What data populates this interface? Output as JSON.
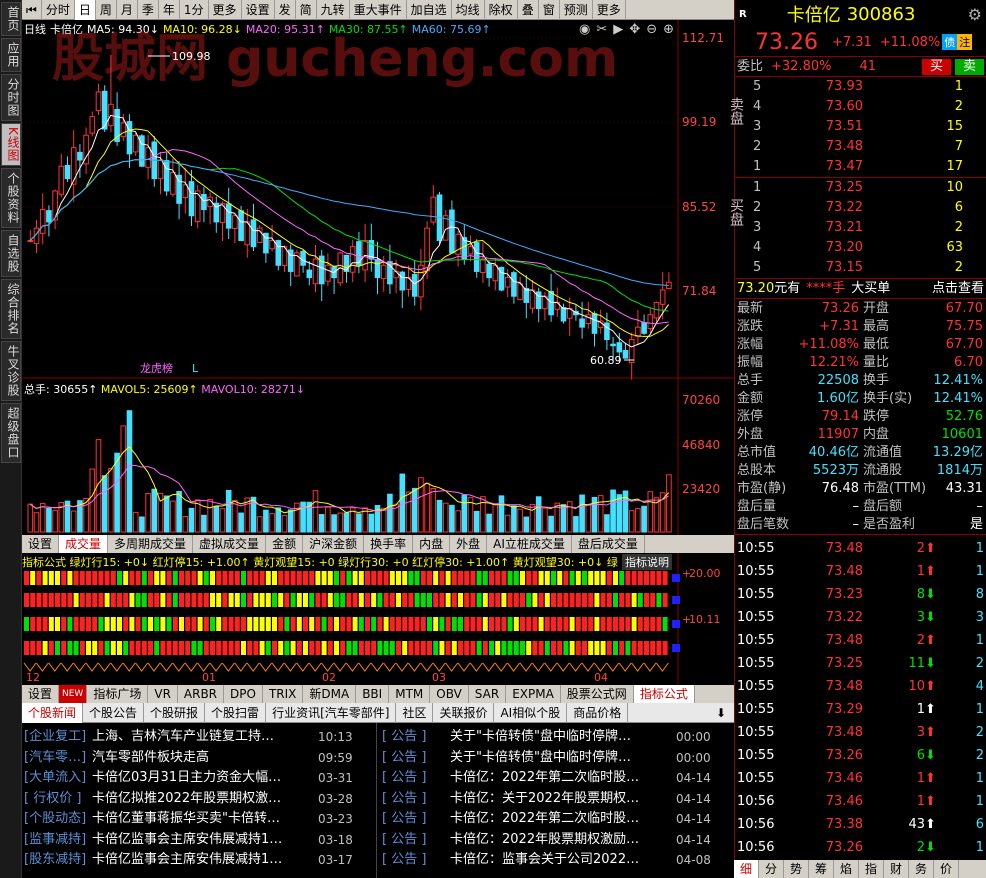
{
  "left_tabs": [
    "首页",
    "应用",
    "分时图",
    "K线图",
    "个股资料",
    "自选股",
    "综合排名",
    "牛叉诊股",
    "超级盘口"
  ],
  "toolbar": [
    "分时",
    "日",
    "周",
    "月",
    "季",
    "年",
    "1分",
    "更多",
    "设置",
    "发",
    "简",
    "九转",
    "重大事件",
    "加自选",
    "均线",
    "除权",
    "叠",
    "窗",
    "预测",
    "更多"
  ],
  "watermark": "股城网 gucheng.com",
  "chart_head": {
    "type": "日线",
    "name": "卡倍亿",
    "ma5": "MA5: 94.30↓",
    "ma10": "MA10: 96.28↓",
    "ma20": "MA20: 95.31↑",
    "ma30": "MA30: 87.55↑",
    "ma60": "MA60: 75.69↑"
  },
  "price_axis": [
    "112.71",
    "99.19",
    "85.52",
    "71.84"
  ],
  "high_label": "109.98",
  "low_label": "60.89",
  "markers": [
    "龙虎榜",
    "L"
  ],
  "vol_head": {
    "total": "总手: 30655↑",
    "mavol5": "MAVOL5: 25609↑",
    "mavol10": "MAVOL10: 28271↓"
  },
  "vol_axis": [
    "70260",
    "46840",
    "23420"
  ],
  "tabs1": [
    "设置",
    "成交量",
    "多周期成交量",
    "虚拟成交量",
    "金额",
    "沪深金额",
    "换手率",
    "内盘",
    "外盘",
    "AI立桩成交量",
    "盘后成交量"
  ],
  "ind_head": "指标公式 绿灯行15: +0↓ 红灯停15: +1.00↑ 黄灯观望15: +0 绿灯行30: +0 红灯停30: +1.00↑ 黄灯观望30: +0↓ 绿",
  "ind_head_right": "指标说明",
  "ind_axis": [
    "20.00",
    "10.11"
  ],
  "date_axis": [
    "12",
    "01",
    "02",
    "03",
    "04"
  ],
  "tabs2": [
    "设置",
    "NEW",
    "指标广场",
    "VR",
    "ARBR",
    "DPO",
    "TRIX",
    "新DMA",
    "BBI",
    "MTM",
    "OBV",
    "SAR",
    "EXPMA",
    "股票公式网",
    "指标公式"
  ],
  "news_tabs": [
    "个股新闻",
    "个股公告",
    "个股研报",
    "个股扫雷",
    "行业资讯[汽车零部件]",
    "社区",
    "关联报价",
    "AI相似个股",
    "商品价格"
  ],
  "news_left": [
    {
      "cat": "[企业复工]",
      "title": "上海、吉林汽车产业链复工持…",
      "date": "10:13"
    },
    {
      "cat": "[汽车零…]",
      "title": "汽车零部件板块走高",
      "date": "09:59"
    },
    {
      "cat": "[大单流入]",
      "title": "卡倍亿03月31日主力资金大幅…",
      "date": "03-31"
    },
    {
      "cat": "[ 行权价 ]",
      "title": "卡倍亿拟推2022年股票期权激…",
      "date": "03-28"
    },
    {
      "cat": "[个股动态]",
      "title": "卡倍亿董事蒋振华买卖\"卡倍转…",
      "date": "03-23"
    },
    {
      "cat": "[监事减持]",
      "title": "卡倍亿监事会主席安伟展减持1…",
      "date": "03-18"
    },
    {
      "cat": "[股东减持]",
      "title": "卡倍亿监事会主席安伟展减持1…",
      "date": "03-17"
    }
  ],
  "news_right": [
    {
      "cat": "[  公告  ]",
      "title": "关于\"卡倍转债\"盘中临时停牌…",
      "date": "00:00"
    },
    {
      "cat": "[  公告  ]",
      "title": "关于\"卡倍转债\"盘中临时停牌…",
      "date": "00:00"
    },
    {
      "cat": "[  公告  ]",
      "title": "卡倍亿：2022年第二次临时股…",
      "date": "04-14"
    },
    {
      "cat": "[  公告  ]",
      "title": "卡倍亿：关于2022年股票期权…",
      "date": "04-14"
    },
    {
      "cat": "[  公告  ]",
      "title": "卡倍亿：2022年第二次临时股…",
      "date": "04-14"
    },
    {
      "cat": "[  公告  ]",
      "title": "卡倍亿：2022年股票期权激励…",
      "date": "04-14"
    },
    {
      "cat": "[  公告  ]",
      "title": "卡倍亿：监事会关于公司2022…",
      "date": "04-08"
    }
  ],
  "quote": {
    "r": "R",
    "name": "卡倍亿",
    "code": "300863",
    "price": "73.26",
    "chg": "+7.31",
    "pct": "+11.08%",
    "tag1": "债",
    "tag2": "注",
    "weibi_label": "委比",
    "weibi": "+32.80%",
    "weicha": "41",
    "buy": "买",
    "sell": "卖",
    "sell_label": "卖盘",
    "buy_label": "买盘",
    "asks": [
      [
        "5",
        "73.93",
        "1"
      ],
      [
        "4",
        "73.60",
        "2"
      ],
      [
        "3",
        "73.51",
        "15"
      ],
      [
        "2",
        "73.48",
        "7"
      ],
      [
        "1",
        "73.47",
        "17"
      ]
    ],
    "bids": [
      [
        "1",
        "73.25",
        "10"
      ],
      [
        "2",
        "73.22",
        "6"
      ],
      [
        "3",
        "73.21",
        "2"
      ],
      [
        "4",
        "73.20",
        "63"
      ],
      [
        "5",
        "73.15",
        "2"
      ]
    ],
    "bigorder": {
      "price": "73.20",
      "unit": "元有",
      "hands": "****手",
      "label": "大买单",
      "link": "点击查看"
    },
    "stats": [
      [
        "最新",
        "73.26",
        "开盘",
        "67.70"
      ],
      [
        "涨跌",
        "+7.31",
        "最高",
        "75.75"
      ],
      [
        "涨幅",
        "+11.08%",
        "最低",
        "67.70"
      ],
      [
        "振幅",
        "12.21%",
        "量比",
        "6.70"
      ],
      [
        "总手",
        "22508",
        "换手",
        "12.41%"
      ],
      [
        "金额",
        "1.60亿",
        "换手(实)",
        "12.41%"
      ],
      [
        "涨停",
        "79.14",
        "跌停",
        "52.76"
      ],
      [
        "外盘",
        "11907",
        "内盘",
        "10601"
      ],
      [
        "总市值",
        "40.46亿",
        "流通值",
        "13.29亿"
      ],
      [
        "总股本",
        "5523万",
        "流通股",
        "1814万"
      ],
      [
        "市盈(静)",
        "76.48",
        "市盈(TTM)",
        "43.31"
      ],
      [
        "盘后量",
        "–",
        "盘后额",
        "–"
      ],
      [
        "盘后笔数",
        "–",
        "是否盈利",
        "是"
      ]
    ],
    "ticks": [
      [
        "10:55",
        "73.48",
        "2",
        "up",
        "1"
      ],
      [
        "10:55",
        "73.48",
        "1",
        "up",
        "1"
      ],
      [
        "10:55",
        "73.23",
        "8",
        "dn",
        "8"
      ],
      [
        "10:55",
        "73.22",
        "3",
        "dn",
        "3"
      ],
      [
        "10:55",
        "73.48",
        "2",
        "up",
        "1"
      ],
      [
        "10:55",
        "73.25",
        "11",
        "dn",
        "2"
      ],
      [
        "10:55",
        "73.48",
        "10",
        "up",
        "4"
      ],
      [
        "10:55",
        "73.29",
        "1",
        "wu",
        "1"
      ],
      [
        "10:55",
        "73.48",
        "3",
        "up",
        "2"
      ],
      [
        "10:55",
        "73.26",
        "6",
        "dn",
        "2"
      ],
      [
        "10:55",
        "73.46",
        "1",
        "up",
        "1"
      ],
      [
        "10:56",
        "73.46",
        "1",
        "up",
        "1"
      ],
      [
        "10:56",
        "73.38",
        "43",
        "wu",
        "6"
      ],
      [
        "10:56",
        "73.26",
        "2",
        "dn",
        "1"
      ]
    ],
    "bottom_tabs": [
      "细",
      "分",
      "势",
      "筹",
      "焰",
      "指",
      "财",
      "务",
      "价"
    ]
  },
  "chart_data": {
    "type": "candlestick",
    "title": "",
    "ylim": [
      55,
      115
    ],
    "high": 109.98,
    "low": 60.89,
    "last": 73.26
  },
  "colors": {
    "up": "#ff3333",
    "down": "#44e0ff",
    "ma5": "#ffffff",
    "ma10": "#ffff00",
    "ma20": "#ff66ff",
    "ma30": "#00e000",
    "ma60": "#44aaff"
  }
}
